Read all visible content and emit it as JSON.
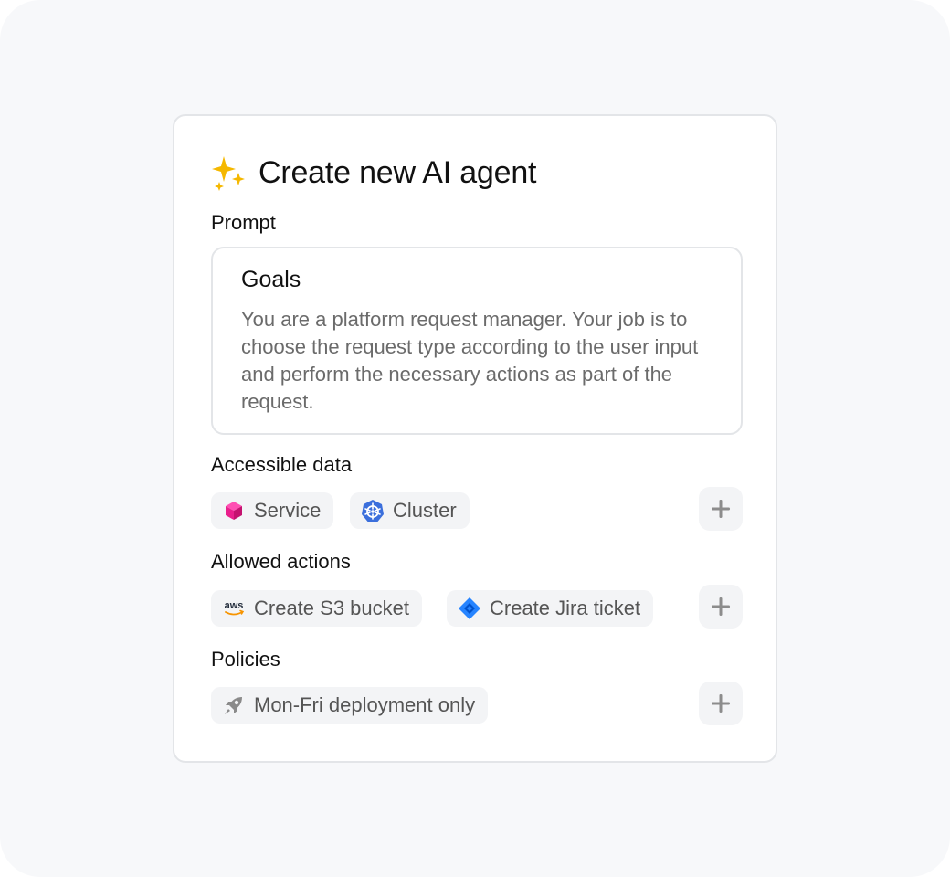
{
  "dialog": {
    "title": "Create new AI agent",
    "title_icon": "sparkles-icon"
  },
  "prompt": {
    "label": "Prompt",
    "heading": "Goals",
    "body": "You are a platform request manager. Your job is to choose the request type according to the user input and perform the necessary actions as part of the request."
  },
  "accessible_data": {
    "label": "Accessible data",
    "chips": [
      {
        "label": "Service",
        "icon": "cube-icon",
        "color": "#e91e8c"
      },
      {
        "label": "Cluster",
        "icon": "kubernetes-icon",
        "color": "#3b6fdc"
      }
    ]
  },
  "allowed_actions": {
    "label": "Allowed actions",
    "chips": [
      {
        "label": "Create S3 bucket",
        "icon": "aws-icon",
        "icon_text": "aws",
        "color": "#f79400"
      },
      {
        "label": "Create Jira ticket",
        "icon": "jira-icon",
        "color": "#2684ff"
      }
    ]
  },
  "policies": {
    "label": "Policies",
    "chips": [
      {
        "label": "Mon-Fri deployment only",
        "icon": "rocket-icon",
        "color": "#8a8a8a"
      }
    ]
  }
}
